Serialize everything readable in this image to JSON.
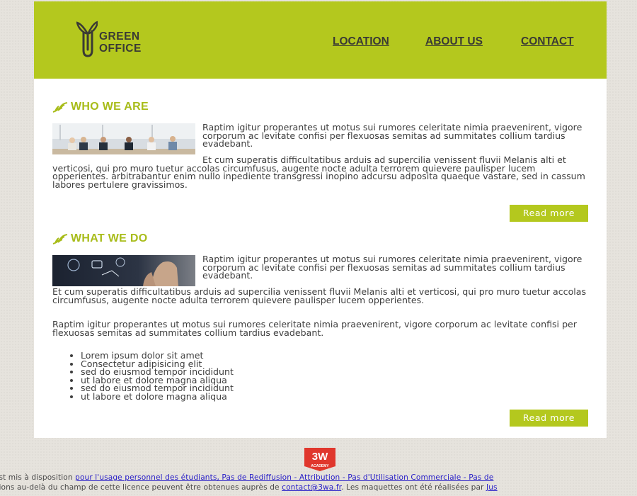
{
  "brand": {
    "line1": "GREEN",
    "line2": "OFFICE",
    "colors": {
      "accent": "#b4c81e",
      "title": "#a8bc1a",
      "text": "#3e3e3e"
    },
    "logo_icon": "paperclip-sprout-icon"
  },
  "nav": {
    "items": [
      "LOCATION",
      "ABOUT US",
      "CONTACT"
    ]
  },
  "who": {
    "title": "WHO WE ARE",
    "para1": "Raptim igitur properantes ut motus sui rumores celeritate nimia praevenirent, vigore corporum ac levitate confisi per flexuosas semitas ad summitates collium tardius evadebant.",
    "para2": "Et cum superatis difficultatibus arduis ad supercilia venissent fluvii Melanis alti et verticosi, qui pro muro tuetur accolas circumfusus, augente nocte adulta terrorem quievere paulisper lucem opperientes. arbitrabantur enim nullo inpediente transgressi inopino adcursu adposita quaeque vastare, sed in cassum labores pertulere gravissimos.",
    "button": "Read more",
    "image": "team-meeting-photo"
  },
  "what": {
    "title": "WHAT WE DO",
    "para1": "Raptim igitur properantes ut motus sui rumores celeritate nimia praevenirent, vigore corporum ac levitate confisi per flexuosas semitas ad summitates collium tardius evadebant.",
    "para2": "Et cum superatis difficultatibus arduis ad supercilia venissent fluvii Melanis alti et verticosi, qui pro muro tuetur accolas circumfusus, augente nocte adulta terrorem quievere paulisper lucem opperientes.",
    "para3": "Raptim igitur properantes ut motus sui rumores celeritate nimia praevenirent, vigore corporum ac levitate confisi per flexuosas semitas ad summitates collium tardius evadebant.",
    "list": [
      "Lorem ipsum dolor sit amet",
      "Consectetur adipisicing elit",
      "sed do eiusmod tempor incididunt",
      "ut labore et dolore magna aliqua",
      "sed do eiusmod tempor incididunt",
      "ut labore et dolore magna aliqua"
    ],
    "button": "Read more",
    "image": "touchscreen-hand-photo"
  },
  "badge": {
    "top": "3W",
    "bottom": "ACADEMY"
  },
  "footer": {
    "line1_pre": "y est mis à disposition ",
    "line1_link": "pour l'usage personnel des étudiants, Pas de Rediffusion - Attribution - Pas d'Utilisation Commerciale - Pas de",
    "line2_pre": "sations au-delà du champ de cette licence peuvent être obtenues auprès de ",
    "line2_email": "contact@3wa.fr",
    "line2_mid": ". Les maquettes ont été réalisées par ",
    "line2_link": "Jus"
  }
}
